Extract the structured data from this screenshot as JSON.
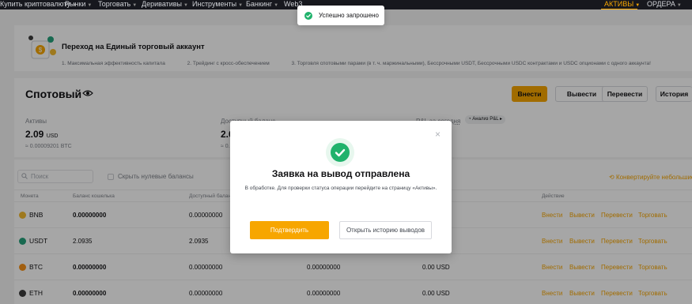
{
  "nav": {
    "items": [
      "Купить криптовалюту",
      "Рынки",
      "Торговать",
      "Деривативы",
      "Инструменты",
      "Банкинг",
      "Web3"
    ],
    "assets": "АКТИВЫ",
    "orders": "ОРДЕРА"
  },
  "banner": {
    "title": "Переход на Единый торговый аккаунт",
    "points": [
      "1. Максимальная эффективность капитала",
      "2. Трейдинг с кросс-обеспечением",
      "3. Торговля спотовыми парами (в т. ч. маржинальными), Бессрочными USDT, Бессрочными USDC контрактами и USDC опционами с одного аккаунта!"
    ]
  },
  "spot": {
    "title": "Спотовый",
    "buttons": {
      "deposit": "Внести",
      "withdraw": "Вывести",
      "transfer": "Перевести",
      "history": "История"
    },
    "assets_label": "Активы",
    "assets_value": "2.09",
    "assets_unit": "USD",
    "assets_btc": "≈ 0.00009201 BTC",
    "available_label": "Доступный баланс",
    "available_value": "2.0",
    "available_sub": "≈ 0.",
    "pnl_label": "P&L за сегодня",
    "pnl_chip": "Анализ P&L"
  },
  "table": {
    "search_placeholder": "Поиск",
    "hide_zero": "Скрыть нулевые балансы",
    "convert": "Конвертируйте небольшие",
    "headers": {
      "coin": "Монета",
      "wallet": "Баланс кошелька",
      "available": "Доступный баланс",
      "action": "Действие"
    },
    "actions": {
      "deposit": "Внести",
      "withdraw": "Вывести",
      "transfer": "Перевести",
      "trade": "Торговать"
    },
    "rows": [
      {
        "coin": "BNB",
        "color": "#f3ba2f",
        "wallet": "0.00000000",
        "available": "0.00000000",
        "c3": "",
        "c4": ""
      },
      {
        "coin": "USDT",
        "color": "#26a17b",
        "wallet": "2.0935",
        "available": "2.0935",
        "c3": "",
        "c4": ""
      },
      {
        "coin": "BTC",
        "color": "#f7931a",
        "wallet": "0.00000000",
        "available": "0.00000000",
        "c3": "0.00000000",
        "c4": "0.00 USD"
      },
      {
        "coin": "ETH",
        "color": "#3c3c3d",
        "wallet": "0.00000000",
        "available": "0.00000000",
        "c3": "0.00000000",
        "c4": "0.00 USD"
      }
    ]
  },
  "modal": {
    "title": "Заявка на вывод отправлена",
    "text": "В обработке. Для проверки статуса операции перейдите на страницу «Активы».",
    "confirm": "Подтвердить",
    "history": "Открыть историю выводов",
    "close": "×"
  },
  "toast": {
    "text": "Успешно запрошено"
  },
  "colors": {
    "accent": "#f7a600",
    "success": "#20b26c"
  }
}
